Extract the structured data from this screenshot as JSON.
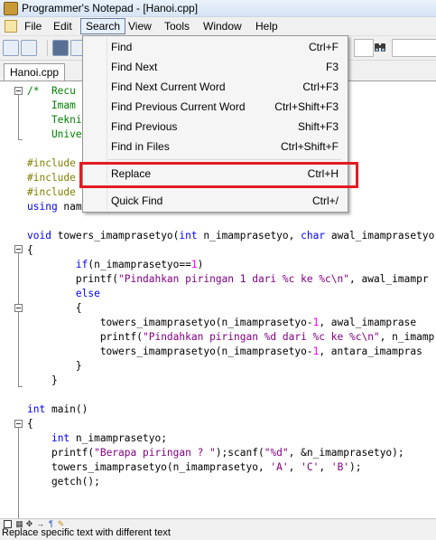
{
  "window": {
    "title": "Programmer's Notepad - [Hanoi.cpp]"
  },
  "menubar": {
    "items": [
      "File",
      "Edit",
      "Search",
      "View",
      "Tools",
      "Window",
      "Help"
    ],
    "active": "Search"
  },
  "tabs": [
    {
      "label": "Hanoi.cpp"
    }
  ],
  "search_menu": {
    "items": [
      {
        "label": "Find",
        "shortcut": "Ctrl+F"
      },
      {
        "label": "Find Next",
        "shortcut": "F3"
      },
      {
        "label": "Find Next Current Word",
        "shortcut": "Ctrl+F3"
      },
      {
        "label": "Find Previous Current Word",
        "shortcut": "Ctrl+Shift+F3"
      },
      {
        "label": "Find Previous",
        "shortcut": "Shift+F3"
      },
      {
        "label": "Find in Files",
        "shortcut": "Ctrl+Shift+F"
      },
      {
        "label": "Replace",
        "shortcut": "Ctrl+H"
      },
      {
        "label": "Quick Find",
        "shortcut": "Ctrl+/"
      }
    ],
    "highlighted": "Replace"
  },
  "code": {
    "lines": [
      [
        [
          "cm",
          "/*  Recu"
        ]
      ],
      [
        [
          "cm",
          "    Imam"
        ]
      ],
      [
        [
          "cm",
          "    Tekni"
        ]
      ],
      [
        [
          "cm",
          "    Unive"
        ]
      ],
      [],
      [
        [
          "pp",
          "#include"
        ]
      ],
      [
        [
          "pp",
          "#include"
        ]
      ],
      [
        [
          "pp",
          "#include"
        ]
      ],
      [
        [
          "kw",
          "using"
        ],
        [
          "",
          " nam"
        ]
      ],
      [],
      [
        [
          "kw",
          "void"
        ],
        [
          "",
          " towers_imamprasetyo("
        ],
        [
          "kw",
          "int"
        ],
        [
          "",
          " n_imamprasetyo, "
        ],
        [
          "kw",
          "char"
        ],
        [
          "",
          " awal_imamprasetyo"
        ]
      ],
      [
        [
          "",
          "{"
        ]
      ],
      [
        [
          "",
          "        "
        ],
        [
          "kw",
          "if"
        ],
        [
          "",
          "(n_imamprasetyo=="
        ],
        [
          "nm",
          "1"
        ],
        [
          "",
          ")"
        ]
      ],
      [
        [
          "",
          "        printf("
        ],
        [
          "st",
          "\"Pindahkan piringan 1 dari %c ke %c\\n\""
        ],
        [
          "",
          ", awal_imampr"
        ]
      ],
      [
        [
          "",
          "        "
        ],
        [
          "kw",
          "else"
        ]
      ],
      [
        [
          "",
          "        {"
        ]
      ],
      [
        [
          "",
          "            towers_imamprasetyo(n_imamprasetyo-"
        ],
        [
          "nm",
          "1"
        ],
        [
          "",
          ", awal_imamprase"
        ]
      ],
      [
        [
          "",
          "            printf("
        ],
        [
          "st",
          "\"Pindahkan piringan %d dari %c ke %c\\n\""
        ],
        [
          "",
          ", n_imamp"
        ]
      ],
      [
        [
          "",
          "            towers_imamprasetyo(n_imamprasetyo-"
        ],
        [
          "nm",
          "1"
        ],
        [
          "",
          ", antara_imampras"
        ]
      ],
      [
        [
          "",
          "        }"
        ]
      ],
      [
        [
          "",
          "    }"
        ]
      ],
      [],
      [
        [
          "kw",
          "int"
        ],
        [
          "",
          " main()"
        ]
      ],
      [
        [
          "",
          "{"
        ]
      ],
      [
        [
          "",
          "    "
        ],
        [
          "kw",
          "int"
        ],
        [
          "",
          " n_imamprasetyo;"
        ]
      ],
      [
        [
          "",
          "    printf("
        ],
        [
          "st",
          "\"Berapa piringan ? \""
        ],
        [
          "",
          ");scanf("
        ],
        [
          "st",
          "\"%d\""
        ],
        [
          "",
          ", &n_imamprasetyo);"
        ]
      ],
      [
        [
          "",
          "    towers_imamprasetyo(n_imamprasetyo, "
        ],
        [
          "st",
          "'A'"
        ],
        [
          "",
          ", "
        ],
        [
          "st",
          "'C'"
        ],
        [
          "",
          ", "
        ],
        [
          "st",
          "'B'"
        ],
        [
          "",
          ");"
        ]
      ],
      [
        [
          "",
          "    getch();"
        ]
      ]
    ]
  },
  "statusbar": {
    "text": "Replace specific text with different text"
  },
  "colors": {
    "highlight_border": "#e31b23",
    "keyword": "#0000ff",
    "comment": "#008000",
    "string": "#800080",
    "preprocessor": "#808000"
  },
  "icons": [
    "app-icon",
    "new-file-icon",
    "open-file-icon",
    "save-icon",
    "find-icon"
  ]
}
